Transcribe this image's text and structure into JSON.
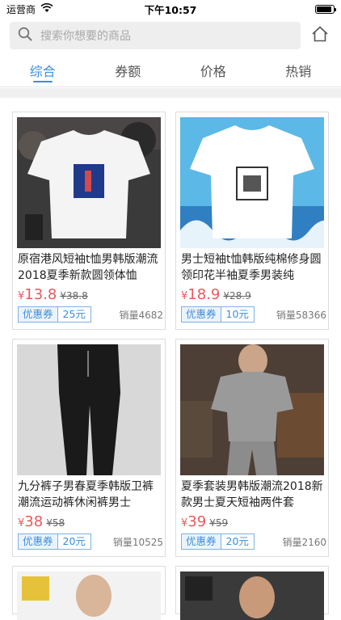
{
  "status": {
    "carrier": "运营商",
    "time": "下午10:57"
  },
  "search": {
    "placeholder": "搜索你想要的商品"
  },
  "tabs": [
    {
      "label": "综合",
      "active": true
    },
    {
      "label": "券额",
      "active": false
    },
    {
      "label": "价格",
      "active": false
    },
    {
      "label": "热销",
      "active": false
    }
  ],
  "products": [
    {
      "title": "原宿港风短袖t恤男韩版潮流2018夏季新款圆领体恤",
      "price_symbol": "¥",
      "price": "13.8",
      "old_price": "¥38.8",
      "coupon_label": "优惠券",
      "coupon_value": "25元",
      "sales": "销量4682"
    },
    {
      "title": "男士短袖t恤韩版纯棉修身圆领印花半袖夏季男装纯",
      "price_symbol": "¥",
      "price": "18.9",
      "old_price": "¥28.9",
      "coupon_label": "优惠券",
      "coupon_value": "10元",
      "sales": "销量58366"
    },
    {
      "title": "九分裤子男春夏季韩版卫裤潮流运动裤休闲裤男士",
      "price_symbol": "¥",
      "price": "38",
      "old_price": "¥58",
      "coupon_label": "优惠券",
      "coupon_value": "20元",
      "sales": "销量10525"
    },
    {
      "title": "夏季套装男韩版潮流2018新款男士夏天短袖两件套",
      "price_symbol": "¥",
      "price": "39",
      "old_price": "¥59",
      "coupon_label": "优惠券",
      "coupon_value": "20元",
      "sales": "销量2160"
    }
  ],
  "colors": {
    "accent": "#3c8ddc",
    "price": "#e8595c"
  }
}
